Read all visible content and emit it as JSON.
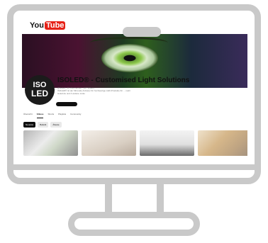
{
  "youtube": {
    "you": "You",
    "tube": "Tube"
  },
  "channel": {
    "name": "ISOLED® - Customised Light Solutions",
    "meta_line1": "@isoled · 2K Abonnenten · 107 Videos",
    "meta_line2": "ISOLED® ist der führende Anbieter für hochwertige LED-Produkte für ... mehr",
    "meta_line3": "isoled.de und 4 weitere Links",
    "avatar_line1": "ISO",
    "avatar_line2": "LED"
  },
  "tabs": [
    "Übersicht",
    "Videos",
    "Shorts",
    "Playlists",
    "Community"
  ],
  "active_tab": "Videos",
  "chips": [
    "Neueste",
    "Beliebt",
    "Älteste"
  ],
  "active_chip": "Neueste"
}
